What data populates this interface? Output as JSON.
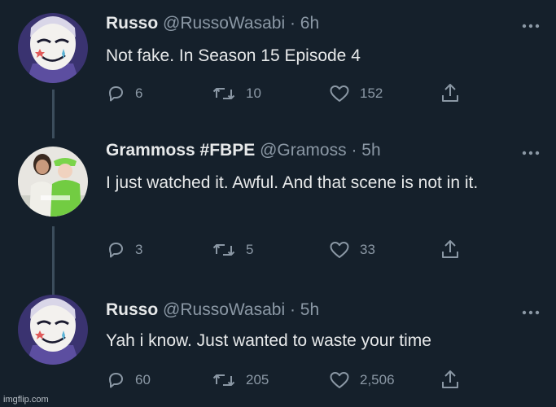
{
  "tweets": [
    {
      "name": "Russo",
      "handle": "@RussoWasabi",
      "time": "· 6h",
      "text": "Not fake. In Season 15 Episode 4",
      "replies": "6",
      "retweets": "10",
      "likes": "152",
      "avatar": "clown-face-avatar"
    },
    {
      "name": "Grammoss #FBPE",
      "handle": "@Gramoss",
      "time": "· 5h",
      "text": "I just watched it. Awful. And that scene is not in it.",
      "replies": "3",
      "retweets": "5",
      "likes": "33",
      "avatar": "two-women-photo-avatar"
    },
    {
      "name": "Russo",
      "handle": "@RussoWasabi",
      "time": "· 5h",
      "text": "Yah i know. Just wanted to waste your time",
      "replies": "60",
      "retweets": "205",
      "likes": "2,506",
      "avatar": "clown-face-avatar"
    }
  ],
  "icons": {
    "reply": "reply-icon",
    "retweet": "retweet-icon",
    "like": "heart-icon",
    "share": "share-icon",
    "more": "more-icon"
  },
  "colors": {
    "background": "#15202b",
    "primary_text": "#e7e9ea",
    "secondary_text": "#8b98a5",
    "thread_line": "#3c4d5c"
  },
  "watermark": "imgflip.com"
}
